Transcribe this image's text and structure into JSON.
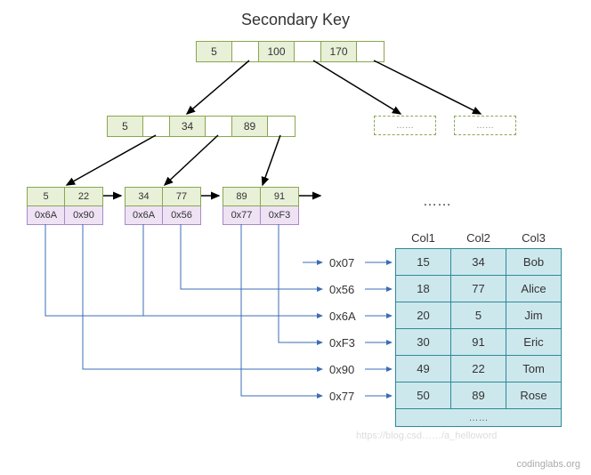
{
  "title": "Secondary Key",
  "root": {
    "keys": [
      "5",
      "100",
      "170"
    ]
  },
  "level1": {
    "keys": [
      "5",
      "34",
      "89"
    ]
  },
  "leaves": [
    {
      "keys": [
        "5",
        "22"
      ],
      "vals": [
        "0x6A",
        "0x90"
      ]
    },
    {
      "keys": [
        "34",
        "77"
      ],
      "vals": [
        "0x6A",
        "0x56"
      ]
    },
    {
      "keys": [
        "89",
        "91"
      ],
      "vals": [
        "0x77",
        "0xF3"
      ]
    }
  ],
  "stubs": {
    "placeholder": "……"
  },
  "ellipsis": "……",
  "pointer_labels": [
    "0x07",
    "0x56",
    "0x6A",
    "0xF3",
    "0x90",
    "0x77"
  ],
  "table": {
    "headers": [
      "Col1",
      "Col2",
      "Col3"
    ],
    "rows": [
      [
        "15",
        "34",
        "Bob"
      ],
      [
        "18",
        "77",
        "Alice"
      ],
      [
        "20",
        "5",
        "Jim"
      ],
      [
        "30",
        "91",
        "Eric"
      ],
      [
        "49",
        "22",
        "Tom"
      ],
      [
        "50",
        "89",
        "Rose"
      ]
    ],
    "footer": "……"
  },
  "watermark": "https://blog.csd……/a_helloword",
  "credit": "codinglabs.org"
}
